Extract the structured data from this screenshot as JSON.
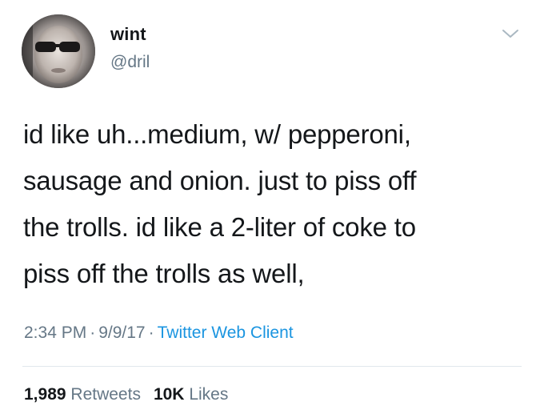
{
  "user": {
    "display_name": "wint",
    "handle": "@dril",
    "avatar_icon": "avatar-photo"
  },
  "tweet": {
    "text": "id like uh...medium, w/ pepperoni,\nsausage and onion. just to piss off\nthe trolls. id like a 2-liter of coke to\npiss off the trolls as well,"
  },
  "meta": {
    "time": "2:34 PM",
    "separator": "·",
    "date": "9/9/17",
    "client": "Twitter Web Client"
  },
  "stats": {
    "retweets_count": "1,989",
    "retweets_label": "Retweets",
    "likes_count": "10K",
    "likes_label": "Likes"
  },
  "colors": {
    "primary_text": "#14171a",
    "secondary_text": "#657786",
    "link": "#1b95e0",
    "divider": "#e1e8ed"
  },
  "icons": {
    "menu": "chevron-down-icon"
  }
}
